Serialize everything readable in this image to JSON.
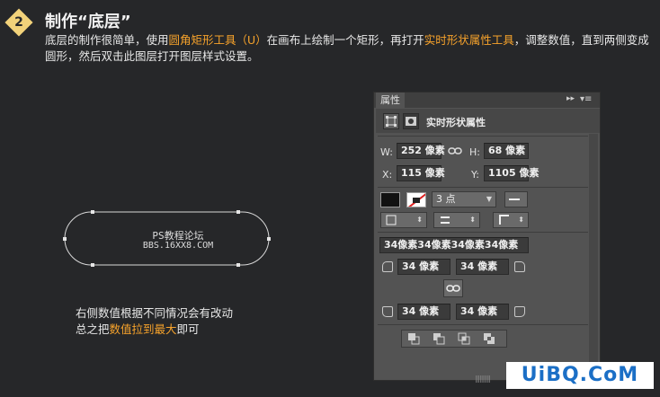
{
  "header": {
    "step_number": "2",
    "title": "制作“底层”",
    "desc_1": "底层的制作很简单，使用",
    "desc_hl1": "圆角矩形工具（U）",
    "desc_2": "在画布上绘制一个矩形，再打开",
    "desc_hl2": "实时形状属性工具",
    "desc_3": "，调整数值，直到两侧变成圆形，然后双击此图层打开图层样式设置。"
  },
  "canvas": {
    "shape_line1": "PS教程论坛",
    "shape_line2": "BBS.16XX8.COM",
    "note_1": "右侧数值根据不同情况会有改动",
    "note_2a": "总之把",
    "note_2_hl": "数值拉到最大",
    "note_2b": "即可"
  },
  "panel": {
    "tab": "属性",
    "collapse": "▸▸",
    "menu": "▾≡",
    "type_label": "实时形状属性",
    "w_label": "W:",
    "w_value": "252 像素",
    "h_label": "H:",
    "h_value": "68 像素",
    "x_label": "X:",
    "x_value": "115 像素",
    "y_label": "Y:",
    "y_value": "1105 像素",
    "stroke_width": "3 点",
    "radius_summary": "34像素34像素34像素34像素",
    "radius_tl": "34 像素",
    "radius_tr": "34 像素",
    "radius_bl": "34 像素",
    "radius_br": "34 像素"
  },
  "watermark": "UiBQ.CoM",
  "colors": {
    "accent": "#f7a32b",
    "background": "#262729",
    "panel": "#535353",
    "badge": "#f2d27a"
  }
}
